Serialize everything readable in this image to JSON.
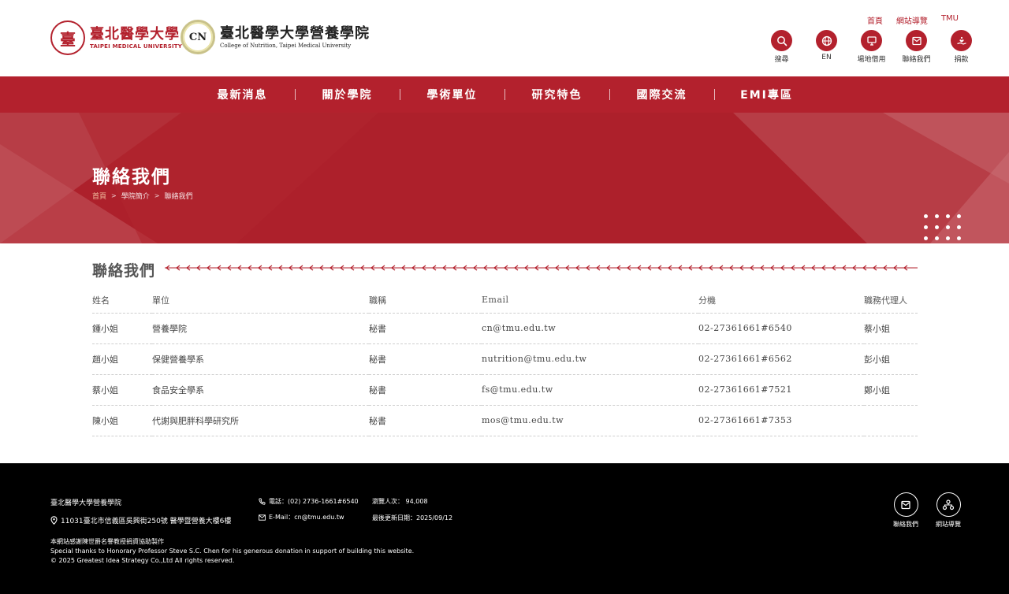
{
  "header": {
    "tmu_logo": {
      "seal_char": "臺",
      "zh": "臺北醫學大學",
      "en": "TAIPEI MEDICAL UNIVERSITY"
    },
    "college_logo": {
      "badge": "CN",
      "zh": "臺北醫學大學營養學院",
      "en": "College of Nutrition, Taipei Medical University"
    },
    "top_links": [
      "首頁",
      "網站導覽",
      "TMU"
    ],
    "quick_links": [
      {
        "label": "搜尋",
        "icon": "search-icon"
      },
      {
        "label": "EN",
        "icon": "globe-icon"
      },
      {
        "label": "場地借用",
        "icon": "venue-icon"
      },
      {
        "label": "聯絡我們",
        "icon": "mail-icon"
      },
      {
        "label": "捐款",
        "icon": "donate-icon"
      }
    ]
  },
  "nav": [
    "最新消息",
    "關於學院",
    "學術單位",
    "研究特色",
    "國際交流",
    "EMI專區"
  ],
  "banner": {
    "title": "聯絡我們",
    "breadcrumb": [
      "首頁",
      "學院簡介",
      "聯絡我們"
    ]
  },
  "main": {
    "section_title": "聯絡我們",
    "columns": [
      "姓名",
      "單位",
      "職稱",
      "Email",
      "分機",
      "職務代理人"
    ],
    "rows": [
      [
        "鍾小姐",
        "營養學院",
        "秘書",
        "cn@tmu.edu.tw",
        "02-27361661#6540",
        "蔡小姐"
      ],
      [
        "趙小姐",
        "保健營養學系",
        "秘書",
        "nutrition@tmu.edu.tw",
        "02-27361661#6562",
        "彭小姐"
      ],
      [
        "蔡小姐",
        "食品安全學系",
        "秘書",
        "fs@tmu.edu.tw",
        "02-27361661#7521",
        "鄭小姐"
      ],
      [
        "陳小姐",
        "代謝與肥胖科學研究所",
        "秘書",
        "mos@tmu.edu.tw",
        "02-27361661#7353",
        ""
      ]
    ]
  },
  "footer": {
    "name": "臺北醫學大學營養學院",
    "address": "11031臺北市信義區吳興街250號 醫學暨營養大樓6樓",
    "tel": "電話：(02) 2736-1661#6540",
    "email": "E-Mail：cn@tmu.edu.tw",
    "visits": "瀏覽人次： 94,008",
    "updated": "最後更新日期：2025/09/12",
    "thanks_zh": "本網站感謝陳世爵名譽教授捐資協助製作",
    "thanks_en": "Special thanks to Honorary Professor Steve S.C. Chen for his generous donation in support of building this website.",
    "copyright": "© 2025 Greatest Idea Strategy Co.,Ltd All rights reserved.",
    "icons": [
      {
        "label": "聯絡我們",
        "icon": "mail-icon"
      },
      {
        "label": "網站導覽",
        "icon": "sitemap-icon"
      }
    ]
  },
  "colors": {
    "brand_red": "#b3212d",
    "footer_bg": "#000000"
  }
}
